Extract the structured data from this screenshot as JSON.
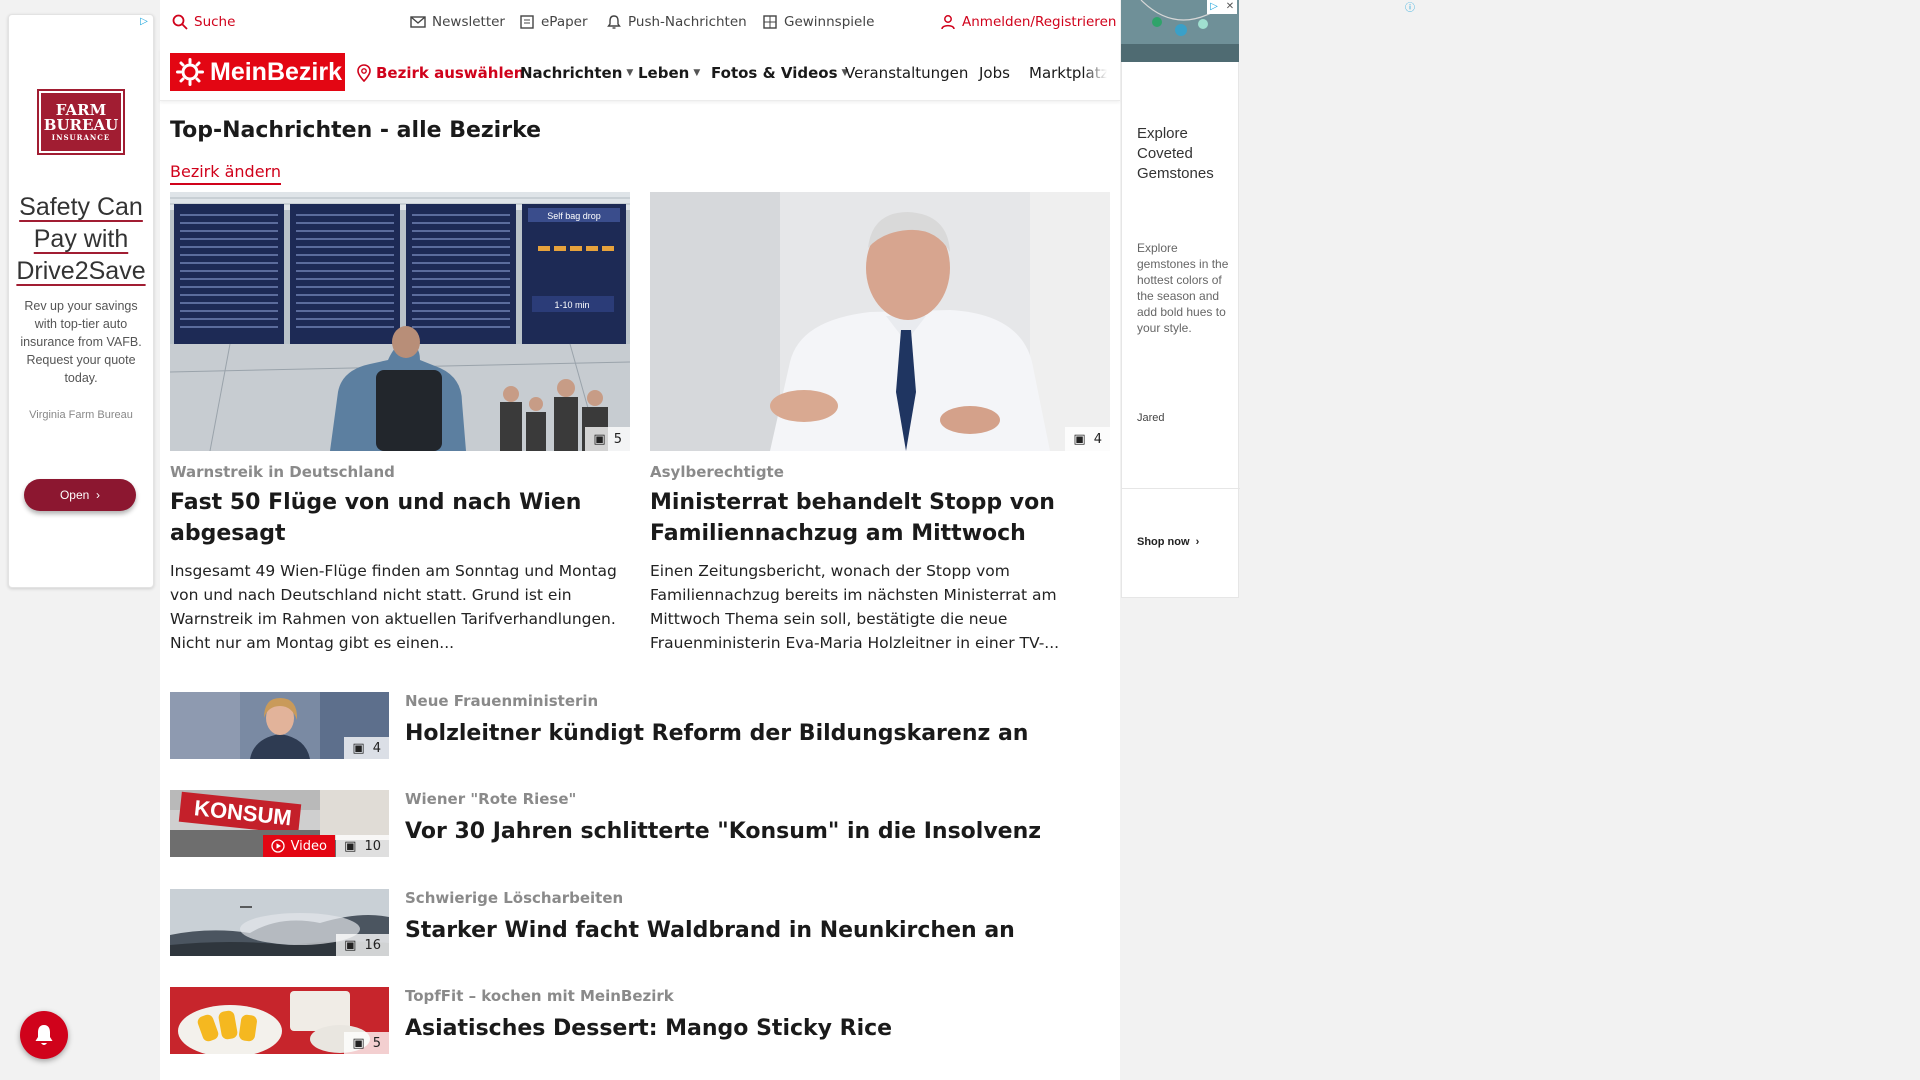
{
  "ad_left": {
    "logo_line1": "FARM",
    "logo_line2": "BUREAU",
    "logo_line3": "INSURANCE",
    "headline_1": "Safety Can",
    "headline_2": "Pay with",
    "headline_3": "Drive2Save",
    "body": "Rev up your savings with top-tier auto insurance from VAFB. Request your quote today.",
    "brand": "Virginia Farm Bureau",
    "button": "Open",
    "button_icon": "chevron-right-icon"
  },
  "topbar": {
    "search": "Suche",
    "newsletter": "Newsletter",
    "epaper": "ePaper",
    "push": "Push-Nachrichten",
    "gewinnspiele": "Gewinnspiele",
    "login": "Anmelden/Registrieren"
  },
  "nav": {
    "logo": "MeinBezirk",
    "bezirk": "Bezirk auswählen",
    "nachrichten": "Nachrichten",
    "leben": "Leben",
    "fotos": "Fotos & Videos",
    "veranstaltungen": "Veranstaltungen",
    "jobs": "Jobs",
    "marktplatz": "Marktplatz"
  },
  "page": {
    "title": "Top-Nachrichten - alle Bezirke",
    "change_bezirk": "Bezirk ändern"
  },
  "featured": [
    {
      "kicker": "Warnstreik in Deutschland",
      "headline": "Fast 50 Flüge von und nach Wien abgesagt",
      "teaser": "Insgesamt 49 Wien-Flüge finden am Sonntag und Montag von und nach Deutschland nicht statt. Grund ist ein Warnstreik im Rahmen von aktuellen Tarifverhandlungen. Nicht nur am Montag gibt es einen...",
      "photo_count": "5",
      "board_sign": "Self bag drop",
      "board_time": "1-10 min"
    },
    {
      "kicker": "Asylberechtigte",
      "headline": "Ministerrat behandelt Stopp von Familiennachzug am Mittwoch",
      "teaser": "Einen Zeitungsbericht, wonach der Stopp vom Familiennachzug bereits im nächsten Ministerrat am Mittwoch Thema sein soll, bestätigte die neue Frauenministerin Eva-Maria Holzleitner in einer TV-...",
      "photo_count": "4"
    }
  ],
  "list": [
    {
      "kicker": "Neue Frauenministerin",
      "headline": "Holzleitner kündigt Reform der Bildungskarenz an",
      "photo_count": "4",
      "video": ""
    },
    {
      "kicker": "Wiener \"Rote Riese\"",
      "headline": "Vor 30 Jahren schlitterte \"Konsum\" in die Insolvenz",
      "photo_count": "10",
      "video": "Video",
      "sign": "KONSUM"
    },
    {
      "kicker": "Schwierige Löscharbeiten",
      "headline": "Starker Wind facht Waldbrand in Neunkirchen an",
      "photo_count": "16",
      "video": ""
    },
    {
      "kicker": "TopfFit – kochen mit MeinBezirk",
      "headline": "Asiatisches Dessert: Mango Sticky Rice",
      "photo_count": "5",
      "video": ""
    }
  ],
  "ad_right": {
    "title": "Explore Coveted Gemstones",
    "body": "Explore gemstones in the hottest colors of the season and add bold hues to your style.",
    "brand": "Jared",
    "shop": "Shop now",
    "shop_icon": "chevron-right-icon"
  },
  "colors": {
    "brand_red": "#e30613",
    "link_red": "#d0021b",
    "ad_red": "#8c1730"
  }
}
